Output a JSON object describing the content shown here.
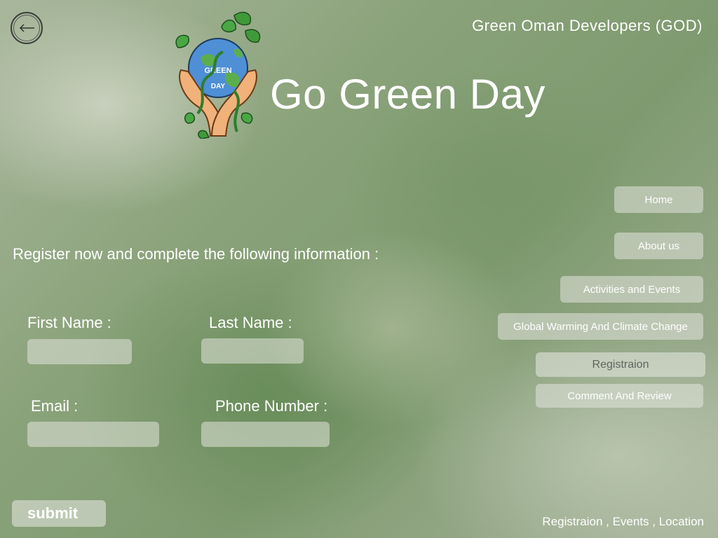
{
  "header": {
    "org_name": "Green Oman Developers (GOD)",
    "site_title": "Go Green Day",
    "logo_text_top": "GREEN",
    "logo_text_bottom": "DAY"
  },
  "form": {
    "intro": "Register now and complete the following information :",
    "first_name_label": "First Name :",
    "last_name_label": "Last Name :",
    "email_label": "Email :",
    "phone_label": "Phone Number :",
    "first_name_value": "",
    "last_name_value": "",
    "email_value": "",
    "phone_value": "",
    "submit_label": "submit"
  },
  "nav": {
    "home": "Home",
    "about": "About us",
    "activities": "Activities and Events",
    "global_warming": "Global Warming And Climate Change",
    "registration": "Registraion",
    "comment": "Comment And Review"
  },
  "footer": {
    "links": "Registraion , Events , Location"
  },
  "colors": {
    "text": "#ffffff",
    "button_bg": "#e1e4dc",
    "active_nav_text": "#5d6660"
  },
  "icons": {
    "back": "back-arrow-icon",
    "logo": "earth-hands-plant-logo"
  }
}
